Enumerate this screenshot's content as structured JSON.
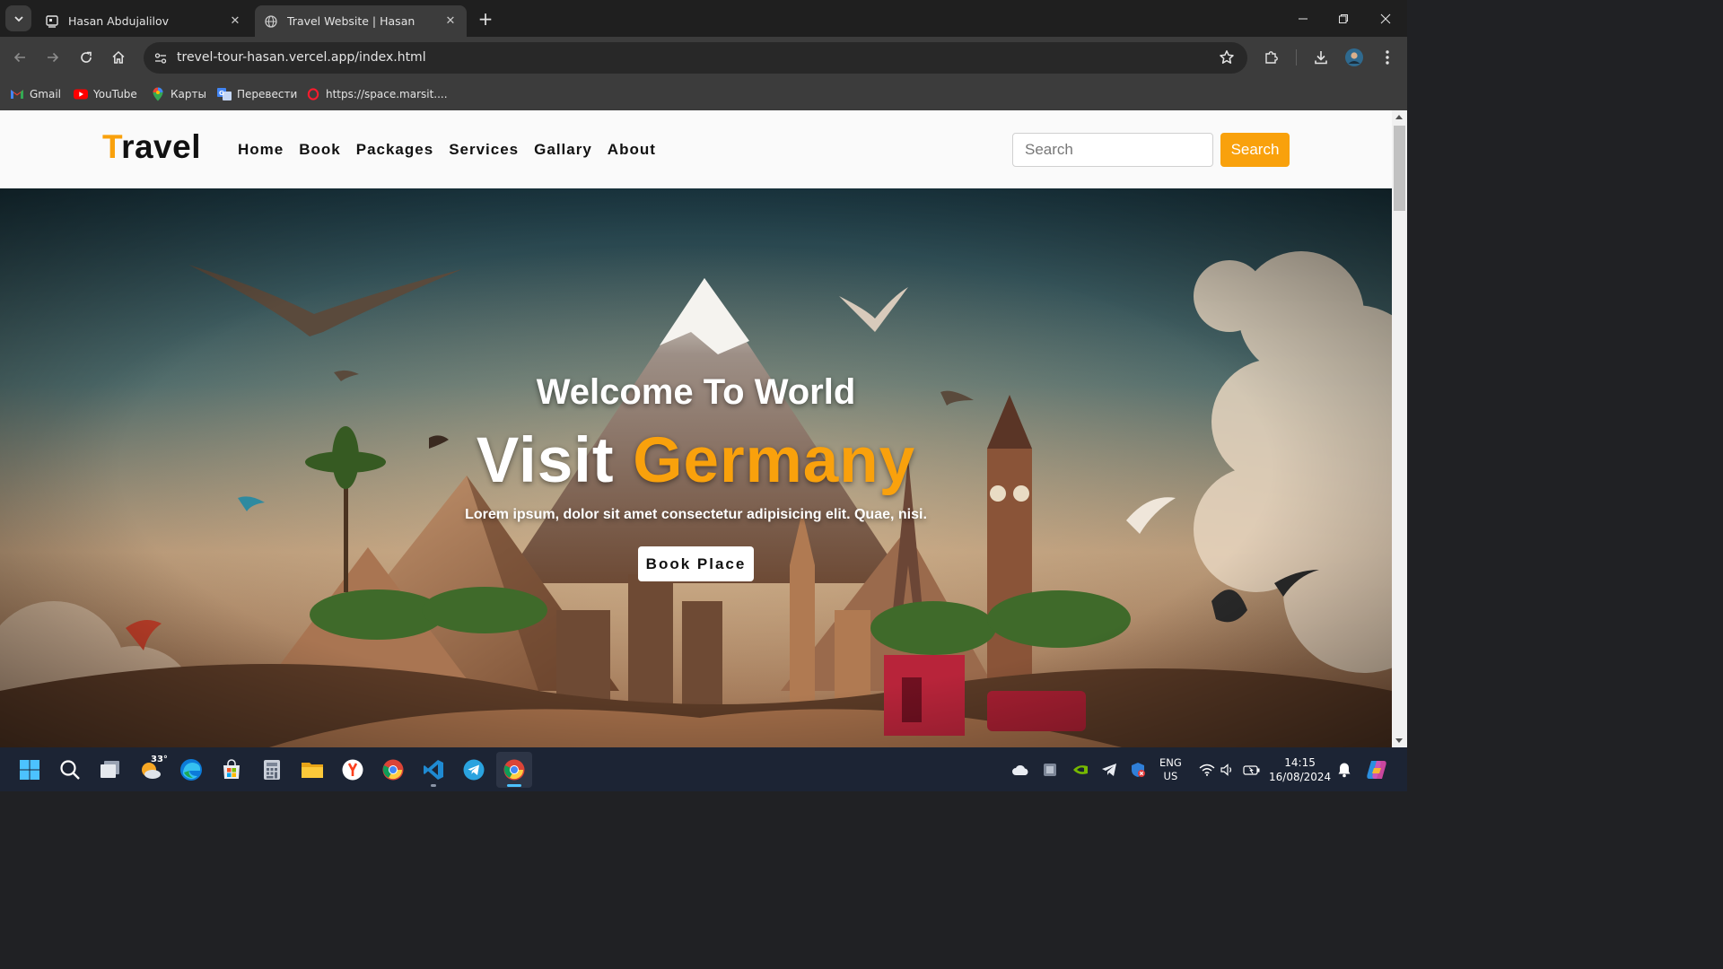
{
  "browser": {
    "tabs": [
      {
        "title": "Hasan Abdujalilov",
        "active": false
      },
      {
        "title": "Travel Website | Hasan",
        "active": true
      }
    ],
    "url": "trevel-tour-hasan.vercel.app/index.html",
    "bookmarks": [
      {
        "label": "Gmail",
        "icon": "gmail-icon"
      },
      {
        "label": "YouTube",
        "icon": "youtube-icon"
      },
      {
        "label": "Карты",
        "icon": "maps-icon"
      },
      {
        "label": "Перевести",
        "icon": "translate-icon"
      },
      {
        "label": "https://space.marsit....",
        "icon": "opera-icon"
      }
    ]
  },
  "site": {
    "logo_first": "T",
    "logo_rest": "ravel",
    "nav": [
      "Home",
      "Book",
      "Packages",
      "Services",
      "Gallary",
      "About"
    ],
    "search_placeholder": "Search",
    "search_button": "Search",
    "hero": {
      "welcome": "Welcome To World",
      "visit": "Visit",
      "destination": "Germany",
      "subtitle": "Lorem ipsum, dolor sit amet consectetur adipisicing elit. Quae, nisi.",
      "cta": "Book Place"
    },
    "accent_color": "#f9a10c"
  },
  "taskbar": {
    "weather_temp": "33°",
    "language_line1": "ENG",
    "language_line2": "US",
    "time": "14:15",
    "date": "16/08/2024",
    "apps": [
      "start-icon",
      "search-icon",
      "task-view-icon",
      "weather-icon",
      "edge-icon",
      "store-icon",
      "calculator-icon",
      "file-explorer-icon",
      "yandex-icon",
      "chrome-icon",
      "vscode-icon",
      "telegram-icon",
      "chrome-active-icon"
    ]
  }
}
